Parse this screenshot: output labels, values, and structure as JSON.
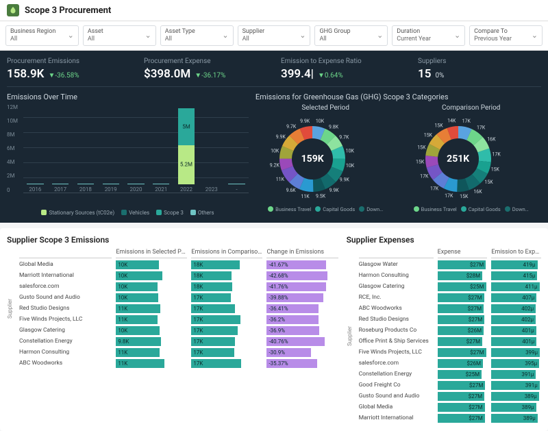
{
  "header": {
    "title": "Scope 3 Procurement"
  },
  "filters": [
    {
      "label": "Business Region",
      "value": "All"
    },
    {
      "label": "Asset",
      "value": "All"
    },
    {
      "label": "Asset Type",
      "value": "All"
    },
    {
      "label": "Supplier",
      "value": "All"
    },
    {
      "label": "GHG Group",
      "value": "All"
    },
    {
      "label": "Duration",
      "value": "Current Year"
    },
    {
      "label": "Compare To",
      "value": "Previous Year"
    }
  ],
  "kpis": [
    {
      "label": "Procurement Emissions",
      "value": "158.9K",
      "delta": "▼-36.58%",
      "cls": "down"
    },
    {
      "label": "Procurement Expense",
      "value": "$398.0M",
      "delta": "▼-36.17%",
      "cls": "down"
    },
    {
      "label": "Emission to Expense Ratio",
      "value": "399.4|",
      "delta": "▼0.64%",
      "cls": "down"
    },
    {
      "label": "Suppliers",
      "value": "15",
      "delta": "0%",
      "cls": ""
    }
  ],
  "emissionsChart": {
    "title": "Emissions Over Time",
    "yticks": [
      "12M",
      "10M",
      "8M",
      "6M",
      "4M",
      "2M",
      "0"
    ],
    "legend": [
      {
        "name": "Stationary Sources (tC02e)",
        "color": "#b8e986"
      },
      {
        "name": "Vehicles",
        "color": "#1a6e6e"
      },
      {
        "name": "Scope 3",
        "color": "#2aa89a"
      },
      {
        "name": "Others",
        "color": "#6fc4c4"
      }
    ]
  },
  "donutSection": {
    "title": "Emissions for Greenhouse Gas (GHG) Scope 3 Categories",
    "left": {
      "title": "Selected Period",
      "center": "159K"
    },
    "right": {
      "title": "Comparison Period",
      "center": "251K"
    },
    "legend": [
      {
        "name": "Business Travel",
        "color": "#6dd68a"
      },
      {
        "name": "Capital Goods",
        "color": "#2aa89a"
      },
      {
        "name": "Down…",
        "color": "#1a6e6e"
      }
    ]
  },
  "supplierEmissions": {
    "title": "Supplier Scope 3 Emissions",
    "cols": [
      "Emissions in Selected Perio…",
      "Emissions in Comparison P…",
      "Change in Emissions"
    ]
  },
  "supplierExpenses": {
    "title": "Supplier Expenses",
    "cols": [
      "Expense",
      "Emission to Expe…"
    ]
  },
  "chart_data": [
    {
      "type": "bar",
      "title": "Emissions Over Time",
      "categories": [
        "2016",
        "2017",
        "2018",
        "2019",
        "2020",
        "2021",
        "2022",
        "2023",
        "-"
      ],
      "series": [
        {
          "name": "Stationary Sources (tC02e)",
          "values": [
            0,
            0,
            0,
            0,
            0,
            0,
            5.2,
            0,
            0
          ]
        },
        {
          "name": "Vehicles",
          "values": [
            0,
            0,
            0,
            0,
            0,
            0,
            0,
            0,
            0
          ]
        },
        {
          "name": "Scope 3",
          "values": [
            0,
            0,
            0,
            0,
            0,
            0,
            5.0,
            0,
            0
          ]
        },
        {
          "name": "Others",
          "values": [
            0.06,
            0.06,
            0.06,
            0.06,
            0.06,
            0.06,
            0,
            0,
            0.06
          ]
        }
      ],
      "ylabel": "",
      "ylim": [
        0,
        12
      ],
      "unit": "M"
    },
    {
      "type": "pie",
      "title": "Selected Period",
      "total_label": "159K",
      "slices": [
        {
          "label": "10K",
          "value": 10,
          "color": "#5aa3e0"
        },
        {
          "label": "9.8K",
          "value": 9.8,
          "color": "#6dd68a"
        },
        {
          "label": "9.7K",
          "value": 9.7,
          "color": "#8de39f"
        },
        {
          "label": "10K",
          "value": 10,
          "color": "#2fbcaa"
        },
        {
          "label": "10K",
          "value": 10,
          "color": "#19a190"
        },
        {
          "label": "9.9K",
          "value": 9.9,
          "color": "#157f7a"
        },
        {
          "label": "9.9K",
          "value": 9.9,
          "color": "#126a6c"
        },
        {
          "label": "9.5K",
          "value": 9.5,
          "color": "#0f565b"
        },
        {
          "label": "11K",
          "value": 11,
          "color": "#2a9ad1"
        },
        {
          "label": "9.6K",
          "value": 9.6,
          "color": "#5d7ed6"
        },
        {
          "label": "11K",
          "value": 11,
          "color": "#7555c6"
        },
        {
          "label": "9.2K",
          "value": 9.2,
          "color": "#9b49b9"
        },
        {
          "label": "10K",
          "value": 10,
          "color": "#a0a43a"
        },
        {
          "label": "9.9K",
          "value": 9.9,
          "color": "#d6a938"
        },
        {
          "label": "9.7K",
          "value": 9.7,
          "color": "#e77e36"
        },
        {
          "label": "9.9K",
          "value": 9.9,
          "color": "#e14b3b"
        }
      ]
    },
    {
      "type": "pie",
      "title": "Comparison Period",
      "total_label": "251K",
      "slices": [
        {
          "label": "17K",
          "value": 17,
          "color": "#5aa3e0"
        },
        {
          "label": "17K",
          "value": 17,
          "color": "#6dd68a"
        },
        {
          "label": "16K",
          "value": 16,
          "color": "#8de39f"
        },
        {
          "label": "17K",
          "value": 17,
          "color": "#2fbcaa"
        },
        {
          "label": "15K",
          "value": 15,
          "color": "#19a190"
        },
        {
          "label": "15K",
          "value": 15,
          "color": "#157f7a"
        },
        {
          "label": "16K",
          "value": 16,
          "color": "#126a6c"
        },
        {
          "label": "15K",
          "value": 15,
          "color": "#0f565b"
        },
        {
          "label": "17K",
          "value": 17,
          "color": "#2a9ad1"
        },
        {
          "label": "17K",
          "value": 17,
          "color": "#5d7ed6"
        },
        {
          "label": "17K",
          "value": 17,
          "color": "#7555c6"
        },
        {
          "label": "15K",
          "value": 15,
          "color": "#9b49b9"
        },
        {
          "label": "15K",
          "value": 15,
          "color": "#a0a43a"
        },
        {
          "label": "15K",
          "value": 15,
          "color": "#d6a938"
        },
        {
          "label": "15K",
          "value": 15,
          "color": "#e77e36"
        },
        {
          "label": "14K",
          "value": 14,
          "color": "#e14b3b"
        }
      ]
    },
    {
      "type": "table",
      "title": "Supplier Scope 3 Emissions",
      "columns": [
        "Supplier",
        "Emissions in Selected Period",
        "Emissions in Comparison Period",
        "Change in Emissions"
      ],
      "rows": [
        [
          "Global Media",
          "10K",
          "18K",
          "-41.67%"
        ],
        [
          "Marriott International",
          "10K",
          "18K",
          "-42.68%"
        ],
        [
          "salesforce.com",
          "10K",
          "18K",
          "-41.76%"
        ],
        [
          "Gusto Sound and Audio",
          "10K",
          "17K",
          "-39.88%"
        ],
        [
          "Red Studio Designs",
          "11K",
          "17K",
          "-36.41%"
        ],
        [
          "Five Winds Projects, LLC",
          "11K",
          "17K",
          "-36.2%"
        ],
        [
          "Glasgow Catering",
          "10K",
          "17K",
          "-36.9%"
        ],
        [
          "Constellation Energy",
          "9.8K",
          "17K",
          "-40.76%"
        ],
        [
          "Harmon Consulting",
          "11K",
          "17K",
          "-30.9%"
        ],
        [
          "ABC Woodworks",
          "11K",
          "17K",
          "-35.37%"
        ]
      ]
    },
    {
      "type": "table",
      "title": "Supplier Expenses",
      "columns": [
        "Supplier",
        "Expense",
        "Emission to Expense"
      ],
      "rows": [
        [
          "Glasgow Water",
          "$27M",
          "419µ"
        ],
        [
          "Harmon Consulting",
          "$28M",
          "415µ"
        ],
        [
          "Glasgow Catering",
          "$25M",
          "411µ"
        ],
        [
          "RCE, Inc.",
          "$27M",
          "407µ"
        ],
        [
          "ABC Woodworks",
          "$27M",
          "402µ"
        ],
        [
          "Red Studio Designs",
          "$27M",
          "402µ"
        ],
        [
          "Roseburg Products Co",
          "$26M",
          "401µ"
        ],
        [
          "Office Print & Ship Services",
          "$27M",
          "401µ"
        ],
        [
          "Five Winds Projects, LLC",
          "$27M",
          "399µ"
        ],
        [
          "salesforce.com",
          "$26M",
          "395µ"
        ],
        [
          "Constellation Energy",
          "$25M",
          "391µ"
        ],
        [
          "Good Freight Co",
          "$27M",
          "391µ"
        ],
        [
          "Gusto Sound and Audio",
          "$27M",
          "389µ"
        ],
        [
          "Global Media",
          "$27M",
          "389µ"
        ],
        [
          "Marriott International",
          "$27M",
          "389µ"
        ]
      ]
    }
  ]
}
